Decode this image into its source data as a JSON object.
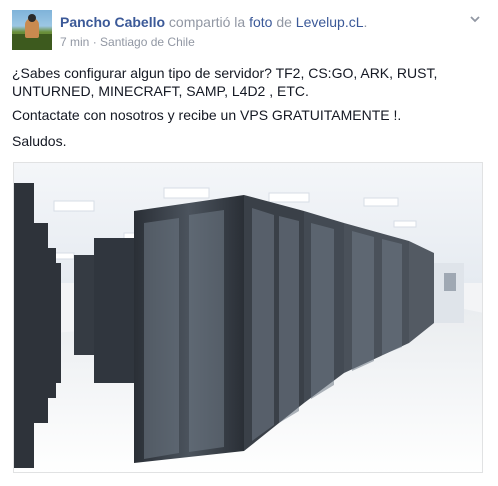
{
  "post": {
    "author": "Pancho Cabello",
    "action_text": "compartió la",
    "object_link": "foto",
    "preposition": "de",
    "page_link": "Levelup.cL",
    "trailing_period": ".",
    "time": "7 min",
    "separator": "·",
    "location": "Santiago de Chile",
    "paragraphs": [
      "¿Sabes configurar algun tipo de servidor? TF2, CS:GO, ARK, RUST, UNTURNED, MINECRAFT, SAMP, L4D2 , ETC.",
      "Contactate con nosotros y recibe un VPS GRATUITAMENTE !.",
      "Saludos."
    ]
  },
  "icons": {
    "options": "chevron-down-icon",
    "avatar": "profile-picture"
  },
  "colors": {
    "link": "#3b5998",
    "muted": "#9197a3",
    "text": "#141823"
  }
}
